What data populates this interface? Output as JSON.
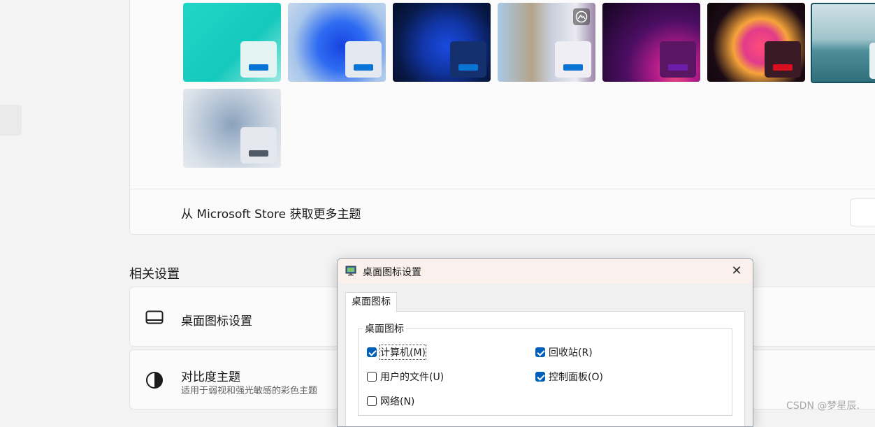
{
  "themes": {
    "items": [
      {
        "bg": "linear-gradient(135deg,#22d6c6,#14c9bd 60%,#9be7e0)",
        "mini_bg": "#e3f4f3",
        "bar": "#0a74d4",
        "badge": false,
        "selected": false
      },
      {
        "bg": "radial-gradient(circle at 55% 55%,#1743e0 0%,#2f6cf2 35%,#a8c6ea 70%,#c9d9ee 100%)",
        "mini_bg": "#e4e9f1",
        "bar": "#0a74d4",
        "badge": false,
        "selected": false
      },
      {
        "bg": "radial-gradient(circle at 55% 55%,#1a4be0 0%,#1236a8 35%,#081a4a 70%,#050d26 100%)",
        "mini_bg": "#15306e",
        "bar": "#0a74d4",
        "badge": false,
        "selected": false
      },
      {
        "bg": "linear-gradient(90deg,#a9c9e6 0%,#b3a48a 35%,#c9cfdc 55%,#e9eaf1 80%,#9b86a8 100%)",
        "mini_bg": "#eeeef4",
        "bar": "#0a74d4",
        "badge": true,
        "selected": false
      },
      {
        "bg": "radial-gradient(circle at 75% 85%,#ff5a7a 0%,#b41d8a 20%,#4c0e63 50%,#12051e 100%)",
        "mini_bg": "#5a1663",
        "bar": "#6b1fa8",
        "badge": false,
        "selected": false
      },
      {
        "bg": "radial-gradient(circle at 55% 55%,#ff4d7a 0%,#e23b8a 25%,#f6a43a 40%,#1b0b14 70%,#0d0509 100%)",
        "mini_bg": "#3a1a24",
        "bar": "#d80f1e",
        "badge": false,
        "selected": false
      },
      {
        "bg": "linear-gradient(180deg,#cfe1e6 0%,#9fc4cb 45%,#4e8f9b 60%,#2f6f7b 100%)",
        "mini_bg": "#e8f2f3",
        "bar": "#1b4f5e",
        "badge": false,
        "selected": true
      },
      {
        "bg": "radial-gradient(circle at 50% 45%,#8aa2bd 0%,#b6c5d6 40%,#d9e0e8 75%,#e6eaef 100%)",
        "mini_bg": "#e4e8ee",
        "bar": "#505a66",
        "badge": false,
        "selected": false
      }
    ]
  },
  "store": {
    "label": "从 Microsoft Store 获取更多主题"
  },
  "related": {
    "title": "相关设置",
    "rows": [
      {
        "title": "桌面图标设置",
        "subtitle": ""
      },
      {
        "title": "对比度主题",
        "subtitle": "适用于弱视和强光敏感的彩色主题"
      }
    ]
  },
  "dialog": {
    "title": "桌面图标设置",
    "close": "✕",
    "tab": "桌面图标",
    "group": "桌面图标",
    "checkboxes": [
      {
        "label": "计算机(M)",
        "checked": true
      },
      {
        "label": "回收站(R)",
        "checked": true
      },
      {
        "label": "用户的文件(U)",
        "checked": false
      },
      {
        "label": "控制面板(O)",
        "checked": true
      },
      {
        "label": "网络(N)",
        "checked": false
      }
    ]
  },
  "watermark": "CSDN @梦星辰."
}
